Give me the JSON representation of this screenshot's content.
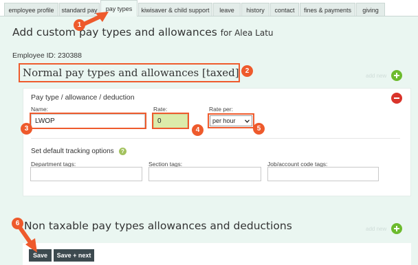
{
  "tabs": [
    {
      "label": "employee profile",
      "active": false
    },
    {
      "label": "standard pay",
      "active": false
    },
    {
      "label": "pay types",
      "active": true
    },
    {
      "label": "kiwisaver & child support",
      "active": false
    },
    {
      "label": "leave",
      "active": false
    },
    {
      "label": "history",
      "active": false
    },
    {
      "label": "contact",
      "active": false
    },
    {
      "label": "fines & payments",
      "active": false
    },
    {
      "label": "giving",
      "active": false
    }
  ],
  "page": {
    "title": "Add custom pay types and allowances",
    "for_text": "for Alea Latu",
    "employee_id": "Employee ID: 230388"
  },
  "taxed_section": {
    "title": "Normal pay types and allowances [taxed]",
    "add_new": "add new"
  },
  "card": {
    "title": "Pay type / allowance / deduction",
    "name_label": "Name:",
    "name_value": "LWOP",
    "rate_label": "Rate:",
    "rate_value": "0",
    "rate_per_label": "Rate per:",
    "rate_per_value": "per hour",
    "tracking_title": "Set default tracking options",
    "help_glyph": "?",
    "department_label": "Department tags:",
    "section_label": "Section tags:",
    "job_label": "Job/account code tags:"
  },
  "non_taxable_section": {
    "title": "Non taxable pay types allowances and deductions",
    "add_new": "add new"
  },
  "buttons": {
    "save": "Save",
    "save_next": "Save + next"
  },
  "annotations": {
    "badge_1": "1",
    "badge_2": "2",
    "badge_3": "3",
    "badge_4": "4",
    "badge_5": "5",
    "badge_6": "6",
    "color": "#ee5a2c"
  },
  "colors": {
    "panel_bg": "#eaf6f1",
    "add_button": "#6dbb2e",
    "remove_button": "#d9342b",
    "rate_field": "#dcebaa",
    "button_dark": "#3d4a4f"
  }
}
